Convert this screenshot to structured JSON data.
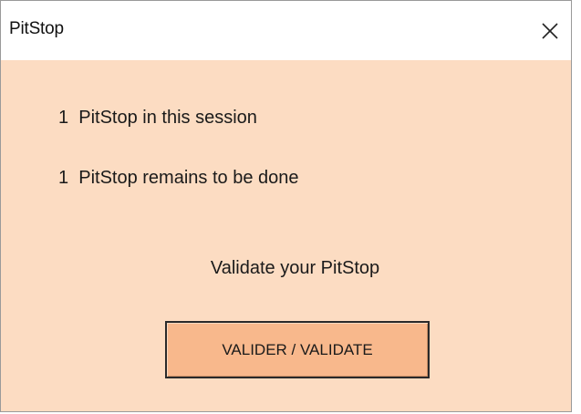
{
  "window": {
    "title": "PitStop",
    "close_icon": "close-icon"
  },
  "content": {
    "session_count_text": "1  PitStop in this session",
    "remaining_text": "1  PitStop remains to be done",
    "prompt_text": "Validate your PitStop",
    "validate_button_label": "VALIDER / VALIDATE"
  },
  "colors": {
    "dialog_background": "#fcdcc2",
    "button_background": "#f8b88c",
    "titlebar_background": "#ffffff"
  }
}
